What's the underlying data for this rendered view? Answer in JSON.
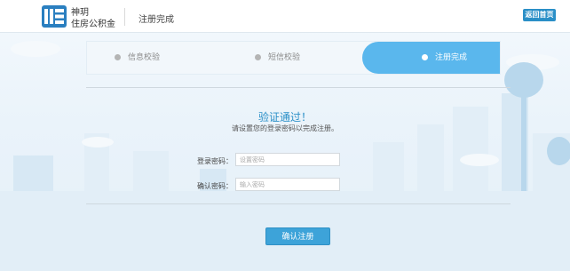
{
  "header": {
    "brand_line1": "神玥",
    "brand_line2": "住房公积金",
    "page_title": "注册完成",
    "home_button": "返回首页"
  },
  "steps": [
    {
      "label": "信息校验",
      "active": false
    },
    {
      "label": "短信校验",
      "active": false
    },
    {
      "label": "注册完成",
      "active": true
    }
  ],
  "result": {
    "title": "验证通过！",
    "subtitle": "请设置您的登录密码以完成注册。"
  },
  "form": {
    "password_label": "登录密码：",
    "password_placeholder": "设置密码",
    "confirm_label": "确认密码：",
    "confirm_placeholder": "输入密码"
  },
  "submit_label": "确认注册",
  "colors": {
    "accent": "#2a8fc7",
    "active_step": "#5ab7ed",
    "button": "#3da3d9"
  }
}
